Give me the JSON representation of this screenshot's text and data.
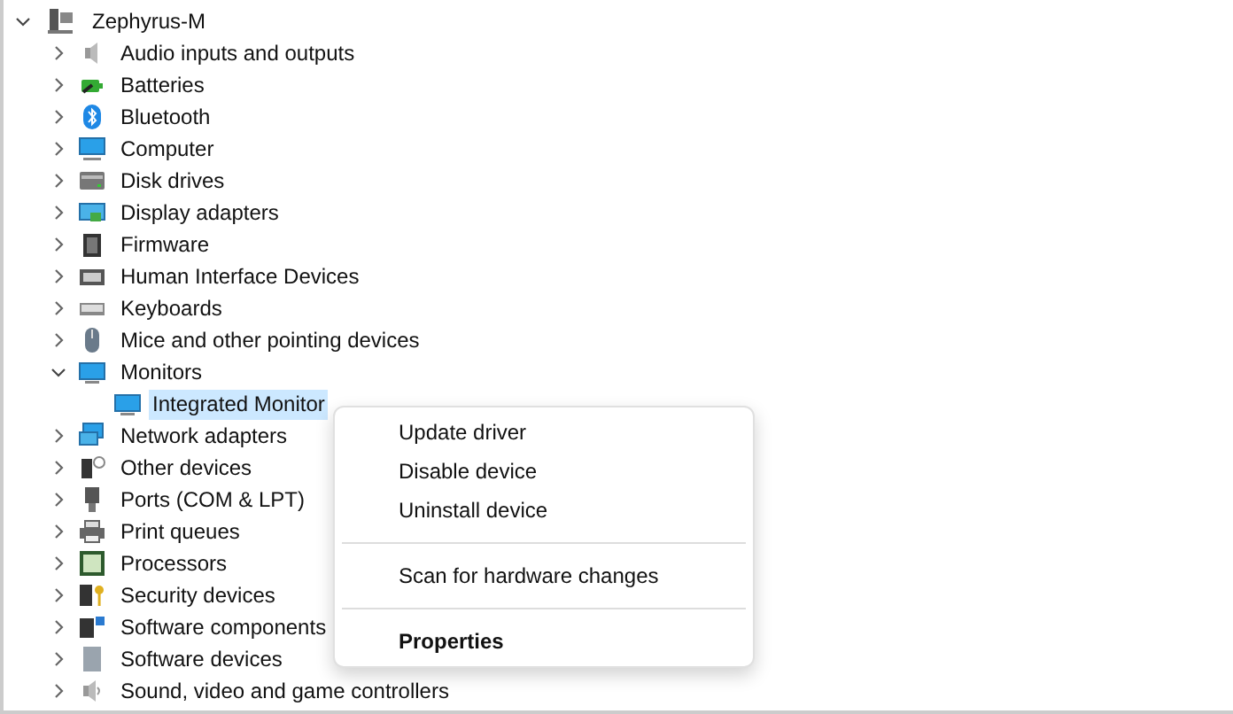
{
  "tree": {
    "label": "Zephyrus-M",
    "expanded": true,
    "selected": false,
    "children": [
      {
        "label": "Audio inputs and outputs",
        "expanded": false,
        "selected": false
      },
      {
        "label": "Batteries",
        "expanded": false,
        "selected": false
      },
      {
        "label": "Bluetooth",
        "expanded": false,
        "selected": false
      },
      {
        "label": "Computer",
        "expanded": false,
        "selected": false
      },
      {
        "label": "Disk drives",
        "expanded": false,
        "selected": false
      },
      {
        "label": "Display adapters",
        "expanded": false,
        "selected": false
      },
      {
        "label": "Firmware",
        "expanded": false,
        "selected": false
      },
      {
        "label": "Human Interface Devices",
        "expanded": false,
        "selected": false
      },
      {
        "label": "Keyboards",
        "expanded": false,
        "selected": false
      },
      {
        "label": "Mice and other pointing devices",
        "expanded": false,
        "selected": false
      },
      {
        "label": "Monitors",
        "expanded": true,
        "selected": false,
        "children": [
          {
            "label": "Integrated Monitor",
            "selected": true
          }
        ]
      },
      {
        "label": "Network adapters",
        "expanded": false,
        "selected": false
      },
      {
        "label": "Other devices",
        "expanded": false,
        "selected": false
      },
      {
        "label": "Ports (COM & LPT)",
        "expanded": false,
        "selected": false
      },
      {
        "label": "Print queues",
        "expanded": false,
        "selected": false
      },
      {
        "label": "Processors",
        "expanded": false,
        "selected": false
      },
      {
        "label": "Security devices",
        "expanded": false,
        "selected": false
      },
      {
        "label": "Software components",
        "expanded": false,
        "selected": false
      },
      {
        "label": "Software devices",
        "expanded": false,
        "selected": false
      },
      {
        "label": "Sound, video and game controllers",
        "expanded": false,
        "selected": false
      }
    ]
  },
  "context_menu": [
    {
      "kind": "item",
      "label": "Update driver",
      "default": false
    },
    {
      "kind": "item",
      "label": "Disable device",
      "default": false
    },
    {
      "kind": "item",
      "label": "Uninstall device",
      "default": false
    },
    {
      "kind": "separator"
    },
    {
      "kind": "item",
      "label": "Scan for hardware changes",
      "default": false
    },
    {
      "kind": "separator"
    },
    {
      "kind": "item",
      "label": "Properties",
      "default": true
    }
  ]
}
